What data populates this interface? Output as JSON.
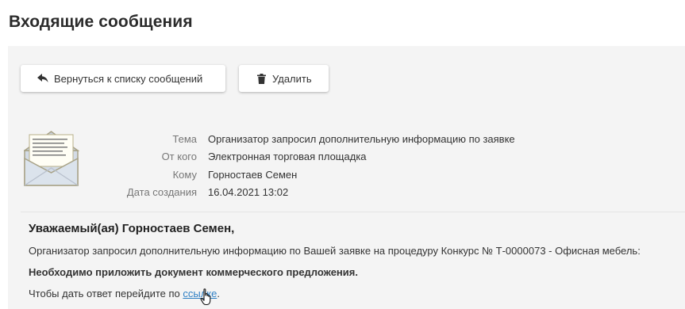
{
  "page": {
    "title": "Входящие сообщения"
  },
  "toolbar": {
    "back_label": "Вернуться к списку сообщений",
    "delete_label": "Удалить"
  },
  "message": {
    "fields": [
      {
        "label": "Тема",
        "value": "Организатор запросил дополнительную информацию по заявке"
      },
      {
        "label": "От кого",
        "value": "Электронная торговая площадка"
      },
      {
        "label": "Кому",
        "value": "Горностаев Семен"
      },
      {
        "label": "Дата создания",
        "value": "16.04.2021 13:02"
      }
    ],
    "greeting": "Уважаемый(ая) Горностаев Семен,",
    "paragraph1": "Организатор запросил дополнительную информацию по Вашей заявке на процедуру Конкурс № Т-0000073 - Офисная мебель:",
    "paragraph2": "Необходимо приложить документ коммерческого предложения.",
    "reply_prefix": "Чтобы дать ответ перейдите по ",
    "reply_link": "ссылке",
    "reply_suffix": "."
  },
  "icons": {
    "back": "reply-arrow-icon",
    "delete": "trash-icon",
    "envelope": "open-envelope-icon"
  },
  "colors": {
    "panel_bg": "#f4f4f4",
    "link": "#2e7fc4",
    "title": "#2b2b2b"
  }
}
